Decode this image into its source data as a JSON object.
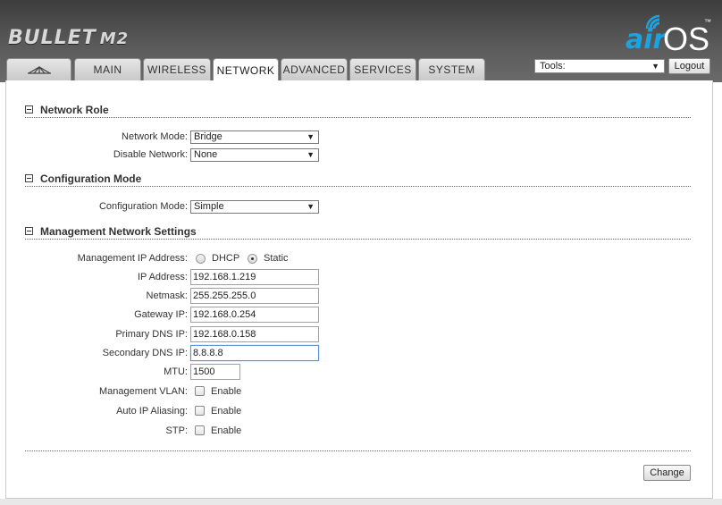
{
  "header": {
    "product_name": "BULLET",
    "product_model": "M2",
    "brand_air": "air",
    "brand_os": "OS",
    "brand_tm": "™"
  },
  "tabs": [
    {
      "label": "",
      "icon": "ubiquiti-logo-icon"
    },
    {
      "label": "MAIN"
    },
    {
      "label": "WIRELESS"
    },
    {
      "label": "NETWORK",
      "active": true
    },
    {
      "label": "ADVANCED"
    },
    {
      "label": "SERVICES"
    },
    {
      "label": "SYSTEM"
    }
  ],
  "tools": {
    "selected": "Tools:",
    "logout_label": "Logout"
  },
  "sections": {
    "network_role": "Network Role",
    "configuration_mode": "Configuration Mode",
    "management_network": "Management Network Settings"
  },
  "fields": {
    "network_mode_label": "Network Mode:",
    "network_mode_value": "Bridge",
    "disable_network_label": "Disable Network:",
    "disable_network_value": "None",
    "config_mode_label": "Configuration Mode:",
    "config_mode_value": "Simple",
    "mgmt_ip_label": "Management IP Address:",
    "mgmt_ip_dhcp": "DHCP",
    "mgmt_ip_static": "Static",
    "mgmt_ip_selected": "Static",
    "ip_address_label": "IP Address:",
    "ip_address_value": "192.168.1.219",
    "netmask_label": "Netmask:",
    "netmask_value": "255.255.255.0",
    "gateway_label": "Gateway IP:",
    "gateway_value": "192.168.0.254",
    "primary_dns_label": "Primary DNS IP:",
    "primary_dns_value": "192.168.0.158",
    "secondary_dns_label": "Secondary DNS IP:",
    "secondary_dns_value": "8.8.8.8",
    "mtu_label": "MTU:",
    "mtu_value": "1500",
    "mgmt_vlan_label": "Management VLAN:",
    "mgmt_vlan_enable": "Enable",
    "auto_ip_label": "Auto IP Aliasing:",
    "auto_ip_enable": "Enable",
    "stp_label": "STP:",
    "stp_enable": "Enable"
  },
  "change_label": "Change",
  "colors": {
    "brand_blue": "#1aa3e0",
    "header_dark": "#3d3d3d"
  }
}
